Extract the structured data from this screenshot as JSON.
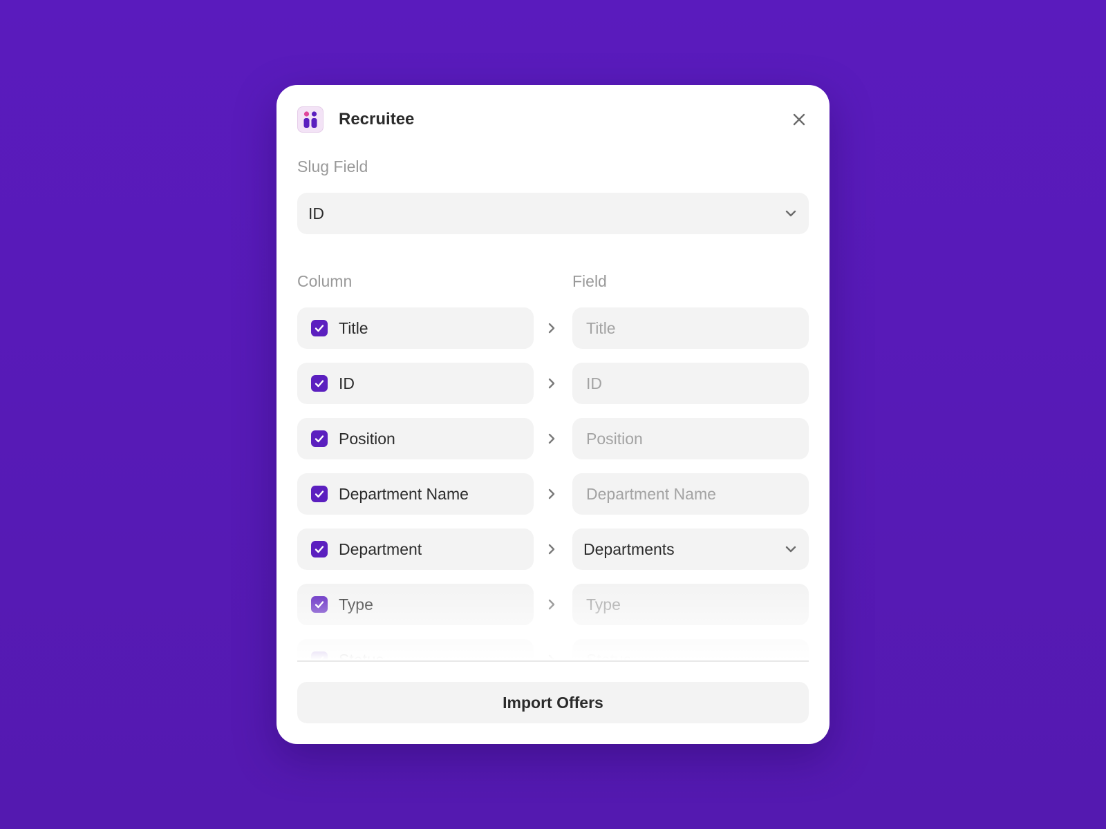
{
  "modal": {
    "app_name": "Recruitee",
    "app_icon": "recruitee-logo-icon",
    "close_icon": "close-icon"
  },
  "slug": {
    "label": "Slug Field",
    "value": "ID"
  },
  "mapping": {
    "column_header": "Column",
    "field_header": "Field",
    "rows": [
      {
        "column": "Title",
        "checked": true,
        "field_placeholder": "Title",
        "field_type": "input"
      },
      {
        "column": "ID",
        "checked": true,
        "field_placeholder": "ID",
        "field_type": "input"
      },
      {
        "column": "Position",
        "checked": true,
        "field_placeholder": "Position",
        "field_type": "input"
      },
      {
        "column": "Department Name",
        "checked": true,
        "field_placeholder": "Department Name",
        "field_type": "input"
      },
      {
        "column": "Department",
        "checked": true,
        "field_value": "Departments",
        "field_type": "select"
      },
      {
        "column": "Type",
        "checked": true,
        "field_placeholder": "Type",
        "field_type": "input"
      },
      {
        "column": "Status",
        "checked": true,
        "field_placeholder": "Status",
        "field_type": "input"
      }
    ]
  },
  "footer": {
    "import_label": "Import Offers"
  },
  "colors": {
    "background": "#5a1bbd",
    "accent": "#5b1fbf",
    "pill": "#f3f3f3"
  }
}
